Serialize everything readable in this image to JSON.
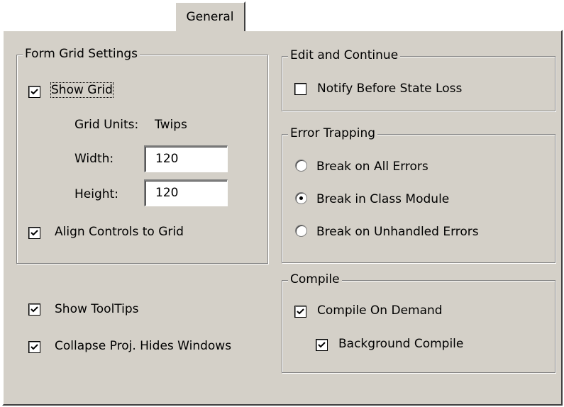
{
  "tab": {
    "label": "General"
  },
  "form_grid": {
    "title": "Form Grid Settings",
    "show_grid": {
      "label": "Show Grid",
      "checked": true
    },
    "grid_units_label": "Grid Units:",
    "grid_units_value": "Twips",
    "width_label": "Width:",
    "width_value": "120",
    "height_label": "Height:",
    "height_value": "120",
    "align_controls": {
      "label": "Align Controls to Grid",
      "checked": true
    }
  },
  "edit_continue": {
    "title": "Edit and Continue",
    "notify": {
      "label": "Notify Before State Loss",
      "checked": false
    }
  },
  "error_trapping": {
    "title": "Error Trapping",
    "options": [
      {
        "label": "Break on All Errors",
        "selected": false
      },
      {
        "label": "Break in Class Module",
        "selected": true
      },
      {
        "label": "Break on Unhandled Errors",
        "selected": false
      }
    ]
  },
  "misc": {
    "show_tooltips": {
      "label": "Show ToolTips",
      "checked": true
    },
    "collapse_proj": {
      "label": "Collapse Proj. Hides Windows",
      "checked": true
    }
  },
  "compile": {
    "title": "Compile",
    "on_demand": {
      "label": "Compile On Demand",
      "checked": true
    },
    "background": {
      "label": "Background Compile",
      "checked": true
    }
  }
}
